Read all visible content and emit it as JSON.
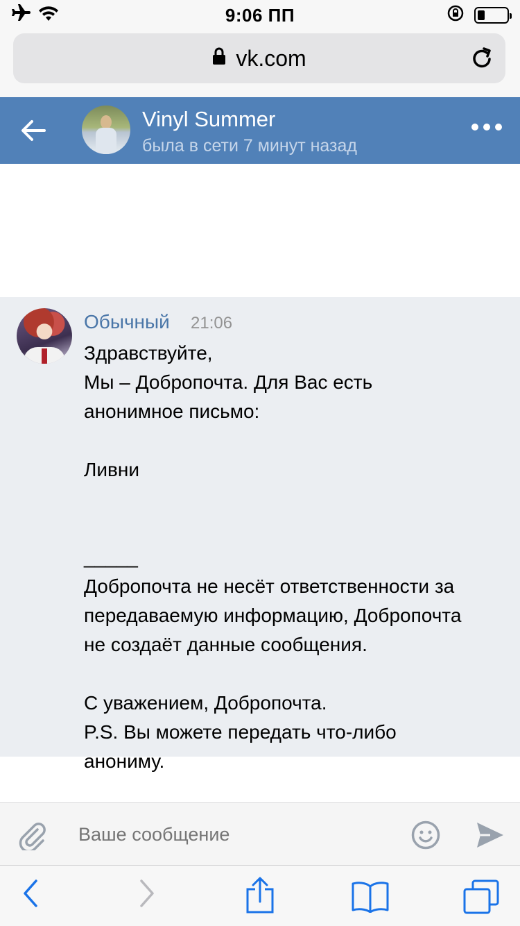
{
  "status_bar": {
    "time": "9:06 ПП",
    "battery_level": 0.25
  },
  "browser": {
    "url": "vk.com"
  },
  "header": {
    "contact_name": "Vinyl Summer",
    "presence": "была в сети 7 минут назад"
  },
  "message": {
    "author": "Обычный",
    "time": "21:06",
    "lines": [
      "Здравствуйте,",
      "Мы – Добропочта. Для Вас есть",
      "анонимное письмо:",
      "",
      "Ливни",
      "",
      "",
      "_____",
      "Добропочта не несёт ответственности за",
      "передаваемую информацию, Добропочта",
      "не создаёт данные сообщения.",
      "",
      "С уважением, Добропочта.",
      "P.S. Вы можете передать что-либо",
      "анониму."
    ]
  },
  "composer": {
    "placeholder": "Ваше сообщение"
  },
  "colors": {
    "header_bg": "#5181b8",
    "author_link": "#4a76a8",
    "ios_blue": "#1a73e8"
  }
}
